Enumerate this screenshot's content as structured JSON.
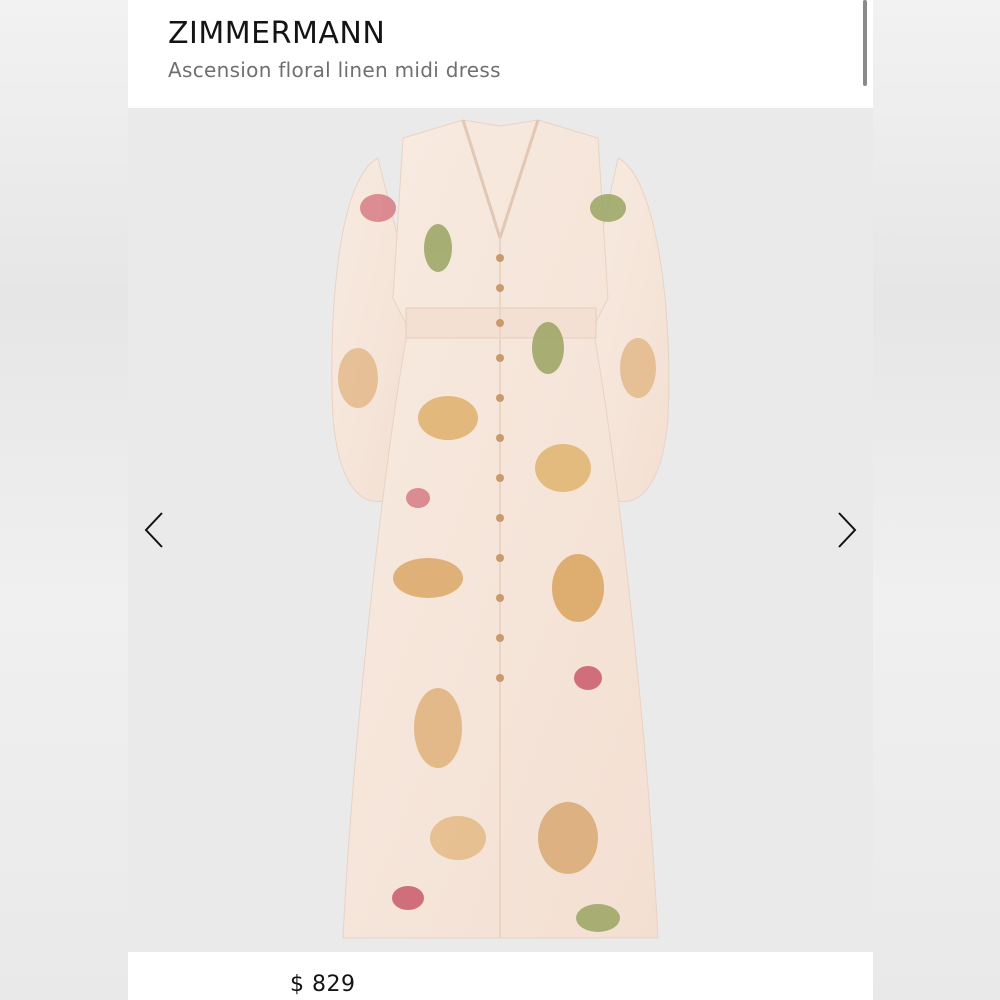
{
  "header": {
    "brand": "ZIMMERMANN",
    "product_name": "Ascension floral linen midi dress"
  },
  "gallery": {
    "image_icon": "floral-dress-illustration",
    "prev_icon": "chevron-left-icon",
    "next_icon": "chevron-right-icon"
  },
  "footer": {
    "price": "$ 829"
  },
  "colors": {
    "dress_base": "#f6e6da",
    "accent_gold": "#d9a45f",
    "accent_pink": "#d77b86",
    "accent_green": "#9aa462"
  }
}
